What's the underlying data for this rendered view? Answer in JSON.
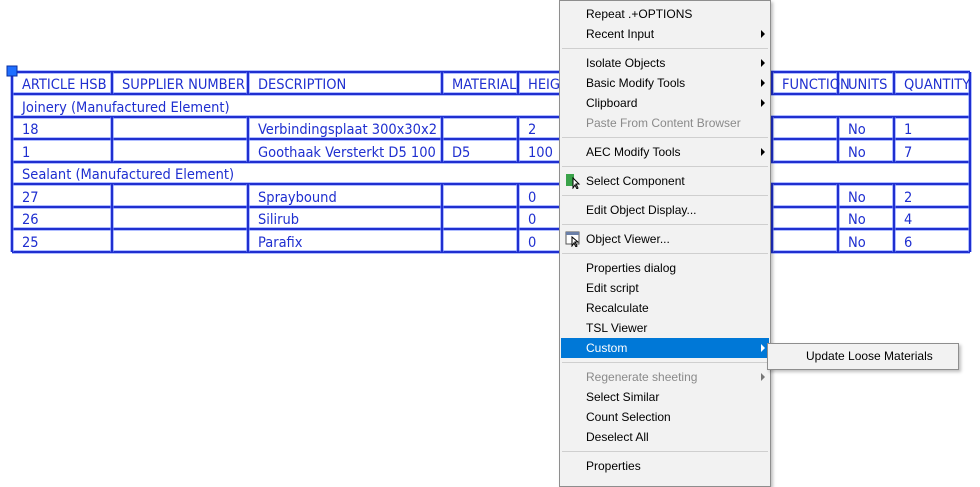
{
  "table": {
    "headers": [
      "ARTICLE HSB",
      "SUPPLIER NUMBER",
      "DESCRIPTION",
      "MATERIAL",
      "HEIGH",
      "FUNCTION",
      "UNITS",
      "QUANTITY"
    ],
    "rows": [
      {
        "type": "group",
        "label": "Joinery (Manufactured Element)"
      },
      {
        "type": "data",
        "cells": [
          "18",
          "",
          "Verbindingsplaat 300x30x2",
          "",
          "2",
          "",
          "No",
          "1"
        ]
      },
      {
        "type": "data",
        "cells": [
          "1",
          "",
          "Goothaak Versterkt D5 100",
          "D5",
          "100",
          "",
          "No",
          "7"
        ]
      },
      {
        "type": "group",
        "label": "Sealant (Manufactured Element)"
      },
      {
        "type": "data",
        "cells": [
          "27",
          "",
          "Spraybound",
          "",
          "0",
          "",
          "No",
          "2"
        ]
      },
      {
        "type": "data",
        "cells": [
          "26",
          "",
          "Silirub",
          "",
          "0",
          "",
          "No",
          "4"
        ]
      },
      {
        "type": "data",
        "cells": [
          "25",
          "",
          "Parafix",
          "",
          "0",
          "",
          "No",
          "6"
        ]
      }
    ]
  },
  "context_menu": {
    "items": [
      {
        "label": "Repeat .+OPTIONS",
        "mnemonic": "R"
      },
      {
        "label": "Recent Input",
        "submenu": true
      },
      {
        "separator": true
      },
      {
        "label": "Isolate Objects",
        "submenu": true,
        "mnemonic": "I"
      },
      {
        "label": "Basic Modify Tools",
        "submenu": true,
        "mnemonic": "B"
      },
      {
        "label": "Clipboard",
        "submenu": true,
        "mnemonic": "C"
      },
      {
        "label": "Paste From Content Browser",
        "disabled": true
      },
      {
        "separator": true
      },
      {
        "label": "AEC Modify Tools",
        "submenu": true
      },
      {
        "separator": true
      },
      {
        "label": "Select Component",
        "icon": "select-component-icon"
      },
      {
        "separator": true
      },
      {
        "label": "Edit Object Display...",
        "mnemonic": "i"
      },
      {
        "separator": true
      },
      {
        "label": "Object Viewer...",
        "icon": "object-viewer-icon"
      },
      {
        "separator": true
      },
      {
        "label": "Properties dialog"
      },
      {
        "label": "Edit script"
      },
      {
        "label": "Recalculate"
      },
      {
        "label": "TSL Viewer"
      },
      {
        "label": "Custom",
        "submenu": true,
        "highlighted": true
      },
      {
        "separator": true
      },
      {
        "label": "Regenerate sheeting",
        "submenu": true,
        "disabled": true
      },
      {
        "label": "Select Similar"
      },
      {
        "label": "Count Selection"
      },
      {
        "label": "Deselect All"
      },
      {
        "separator": true
      },
      {
        "label": "Properties"
      }
    ]
  },
  "submenu": {
    "items": [
      {
        "label": "Update Loose Materials"
      }
    ]
  },
  "colors": {
    "cad_blue": "#1f2fd0",
    "menu_highlight": "#0078d7",
    "menu_bg": "#f2f2f2"
  }
}
